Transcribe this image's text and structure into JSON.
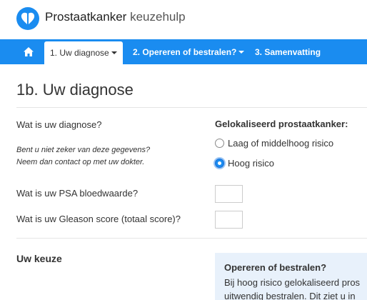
{
  "header": {
    "title_main": "Prostaatkanker",
    "title_sub": "keuzehulp",
    "logo_icon": "heart-split-icon",
    "brand_color": "#1a8cf0"
  },
  "nav": {
    "home_icon": "home-icon",
    "tabs": [
      {
        "label": "1. Uw diagnose",
        "active": true,
        "has_dropdown": true
      },
      {
        "label": "2. Opereren of bestralen?",
        "active": false,
        "has_dropdown": true
      },
      {
        "label": "3. Samenvatting",
        "active": false,
        "has_dropdown": false
      }
    ]
  },
  "main": {
    "section_title": "1b. Uw diagnose",
    "diagnosis_question": "Wat is uw diagnose?",
    "hint_line1": "Bent u niet zeker van deze gegevens?",
    "hint_line2": "Neem dan contact op met uw dokter.",
    "localized_title": "Gelokaliseerd prostaatkanker:",
    "risk_options": [
      {
        "label": "Laag of middelhoog risico",
        "checked": false
      },
      {
        "label": "Hoog risico",
        "checked": true
      }
    ],
    "psa_question": "Wat is uw PSA bloedwaarde?",
    "psa_value": "",
    "gleason_question": "Wat is uw Gleason score (totaal score)?",
    "gleason_value": "",
    "choice_title": "Uw keuze",
    "info_title": "Opereren of bestralen?",
    "info_text_line1": "Bij hoog risico gelokaliseerd pros",
    "info_text_line2": "uitwendig bestralen. Dit ziet u in"
  }
}
